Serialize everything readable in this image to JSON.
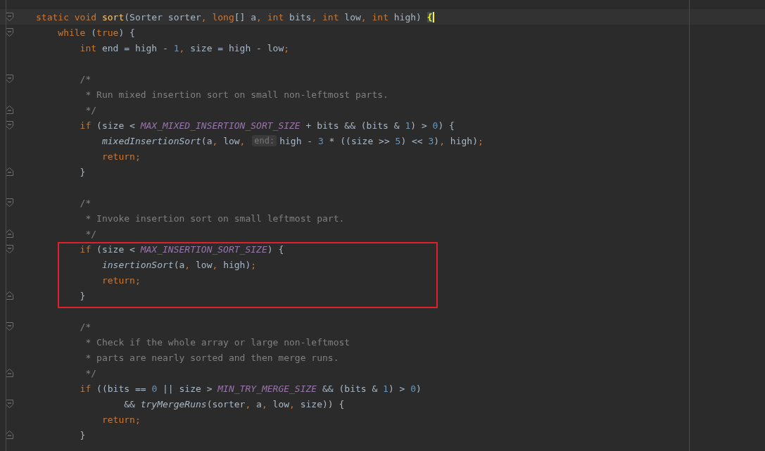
{
  "editor": {
    "lines": [
      {
        "kind": "current",
        "fold_start": true,
        "fold_end": false,
        "tokens": [
          {
            "kind": "kw",
            "text": "static void "
          },
          {
            "kind": "decl",
            "text": "sort"
          },
          {
            "kind": "text",
            "text": "(Sorter sorter"
          },
          {
            "kind": "kw",
            "text": ", long"
          },
          {
            "kind": "text",
            "text": "[] a"
          },
          {
            "kind": "kw",
            "text": ", int "
          },
          {
            "kind": "text",
            "text": "bits"
          },
          {
            "kind": "kw",
            "text": ", int "
          },
          {
            "kind": "text",
            "text": "low"
          },
          {
            "kind": "kw",
            "text": ", int "
          },
          {
            "kind": "text",
            "text": "high) "
          },
          {
            "kind": "brace",
            "text": "{"
          }
        ]
      },
      {
        "kind": "code",
        "fold_start": true,
        "fold_end": false,
        "tokens": [
          {
            "kind": "kw",
            "text": "    while "
          },
          {
            "kind": "text",
            "text": "("
          },
          {
            "kind": "kw",
            "text": "true"
          },
          {
            "kind": "text",
            "text": ") {"
          }
        ]
      },
      {
        "kind": "code",
        "fold_start": false,
        "fold_end": false,
        "tokens": [
          {
            "kind": "kw",
            "text": "        int "
          },
          {
            "kind": "text",
            "text": "end = high - "
          },
          {
            "kind": "num",
            "text": "1"
          },
          {
            "kind": "kw",
            "text": ", "
          },
          {
            "kind": "text",
            "text": "size = high - low"
          },
          {
            "kind": "kw",
            "text": ";"
          }
        ]
      },
      {
        "kind": "blank"
      },
      {
        "kind": "code",
        "fold_start": true,
        "fold_end": false,
        "tokens": [
          {
            "kind": "comment",
            "text": "        /*"
          }
        ]
      },
      {
        "kind": "code",
        "fold_start": false,
        "fold_end": false,
        "tokens": [
          {
            "kind": "comment",
            "text": "         * Run mixed insertion sort on small non-leftmost parts."
          }
        ]
      },
      {
        "kind": "code",
        "fold_start": false,
        "fold_end": true,
        "tokens": [
          {
            "kind": "comment",
            "text": "         */"
          }
        ]
      },
      {
        "kind": "code",
        "fold_start": true,
        "fold_end": false,
        "tokens": [
          {
            "kind": "kw",
            "text": "        if "
          },
          {
            "kind": "text",
            "text": "(size < "
          },
          {
            "kind": "const",
            "text": "MAX_MIXED_INSERTION_SORT_SIZE"
          },
          {
            "kind": "text",
            "text": " + bits && (bits & "
          },
          {
            "kind": "num",
            "text": "1"
          },
          {
            "kind": "text",
            "text": ") > "
          },
          {
            "kind": "num",
            "text": "0"
          },
          {
            "kind": "text",
            "text": ") {"
          }
        ]
      },
      {
        "kind": "code",
        "fold_start": false,
        "fold_end": false,
        "tokens": [
          {
            "kind": "call",
            "text": "            mixedInsertionSort"
          },
          {
            "kind": "text",
            "text": "(a"
          },
          {
            "kind": "kw",
            "text": ", "
          },
          {
            "kind": "text",
            "text": "low"
          },
          {
            "kind": "kw",
            "text": ", "
          },
          {
            "kind": "hint",
            "text": "end:"
          },
          {
            "kind": "text",
            "text": "high - "
          },
          {
            "kind": "num",
            "text": "3"
          },
          {
            "kind": "text",
            "text": " * ((size >> "
          },
          {
            "kind": "num",
            "text": "5"
          },
          {
            "kind": "text",
            "text": ") << "
          },
          {
            "kind": "num",
            "text": "3"
          },
          {
            "kind": "text",
            "text": ")"
          },
          {
            "kind": "kw",
            "text": ", "
          },
          {
            "kind": "text",
            "text": "high)"
          },
          {
            "kind": "kw",
            "text": ";"
          }
        ]
      },
      {
        "kind": "code",
        "fold_start": false,
        "fold_end": false,
        "tokens": [
          {
            "kind": "kw",
            "text": "            return;"
          }
        ]
      },
      {
        "kind": "code",
        "fold_start": false,
        "fold_end": true,
        "tokens": [
          {
            "kind": "text",
            "text": "        }"
          }
        ]
      },
      {
        "kind": "blank"
      },
      {
        "kind": "code",
        "fold_start": true,
        "fold_end": false,
        "tokens": [
          {
            "kind": "comment",
            "text": "        /*"
          }
        ]
      },
      {
        "kind": "code",
        "fold_start": false,
        "fold_end": false,
        "tokens": [
          {
            "kind": "comment",
            "text": "         * Invoke insertion sort on small leftmost part."
          }
        ]
      },
      {
        "kind": "code",
        "fold_start": false,
        "fold_end": true,
        "tokens": [
          {
            "kind": "comment",
            "text": "         */"
          }
        ]
      },
      {
        "kind": "boxed",
        "lines": [
          {
            "kind": "code",
            "fold_start": true,
            "fold_end": false,
            "tokens": [
              {
                "kind": "kw",
                "text": "        if "
              },
              {
                "kind": "text",
                "text": "(size < "
              },
              {
                "kind": "const",
                "text": "MAX_INSERTION_SORT_SIZE"
              },
              {
                "kind": "text",
                "text": ") {"
              }
            ]
          },
          {
            "kind": "code",
            "fold_start": false,
            "fold_end": false,
            "tokens": [
              {
                "kind": "call",
                "text": "            insertionSort"
              },
              {
                "kind": "text",
                "text": "(a"
              },
              {
                "kind": "kw",
                "text": ", "
              },
              {
                "kind": "text",
                "text": "low"
              },
              {
                "kind": "kw",
                "text": ", "
              },
              {
                "kind": "text",
                "text": "high)"
              },
              {
                "kind": "kw",
                "text": ";"
              }
            ]
          },
          {
            "kind": "code",
            "fold_start": false,
            "fold_end": false,
            "tokens": [
              {
                "kind": "kw",
                "text": "            return;"
              }
            ]
          },
          {
            "kind": "code",
            "fold_start": false,
            "fold_end": true,
            "tokens": [
              {
                "kind": "text",
                "text": "        }"
              }
            ]
          }
        ]
      },
      {
        "kind": "blank"
      },
      {
        "kind": "code",
        "fold_start": true,
        "fold_end": false,
        "tokens": [
          {
            "kind": "comment",
            "text": "        /*"
          }
        ]
      },
      {
        "kind": "code",
        "fold_start": false,
        "fold_end": false,
        "tokens": [
          {
            "kind": "comment",
            "text": "         * Check if the whole array or large non-leftmost"
          }
        ]
      },
      {
        "kind": "code",
        "fold_start": false,
        "fold_end": false,
        "tokens": [
          {
            "kind": "comment",
            "text": "         * parts are nearly sorted and then merge runs."
          }
        ]
      },
      {
        "kind": "code",
        "fold_start": false,
        "fold_end": true,
        "tokens": [
          {
            "kind": "comment",
            "text": "         */"
          }
        ]
      },
      {
        "kind": "code",
        "fold_start": false,
        "fold_end": false,
        "tokens": [
          {
            "kind": "kw",
            "text": "        if "
          },
          {
            "kind": "text",
            "text": "((bits == "
          },
          {
            "kind": "num",
            "text": "0"
          },
          {
            "kind": "text",
            "text": " || size > "
          },
          {
            "kind": "const",
            "text": "MIN_TRY_MERGE_SIZE"
          },
          {
            "kind": "text",
            "text": " && (bits & "
          },
          {
            "kind": "num",
            "text": "1"
          },
          {
            "kind": "text",
            "text": ") > "
          },
          {
            "kind": "num",
            "text": "0"
          },
          {
            "kind": "text",
            "text": ")"
          }
        ]
      },
      {
        "kind": "code",
        "fold_start": true,
        "fold_end": false,
        "tokens": [
          {
            "kind": "text",
            "text": "                && "
          },
          {
            "kind": "call",
            "text": "tryMergeRuns"
          },
          {
            "kind": "text",
            "text": "(sorter"
          },
          {
            "kind": "kw",
            "text": ", "
          },
          {
            "kind": "text",
            "text": "a"
          },
          {
            "kind": "kw",
            "text": ", "
          },
          {
            "kind": "text",
            "text": "low"
          },
          {
            "kind": "kw",
            "text": ", "
          },
          {
            "kind": "text",
            "text": "size)) {"
          }
        ]
      },
      {
        "kind": "code",
        "fold_start": false,
        "fold_end": false,
        "tokens": [
          {
            "kind": "kw",
            "text": "            return;"
          }
        ]
      },
      {
        "kind": "code",
        "fold_start": false,
        "fold_end": true,
        "tokens": [
          {
            "kind": "text",
            "text": "        }"
          }
        ]
      }
    ]
  }
}
